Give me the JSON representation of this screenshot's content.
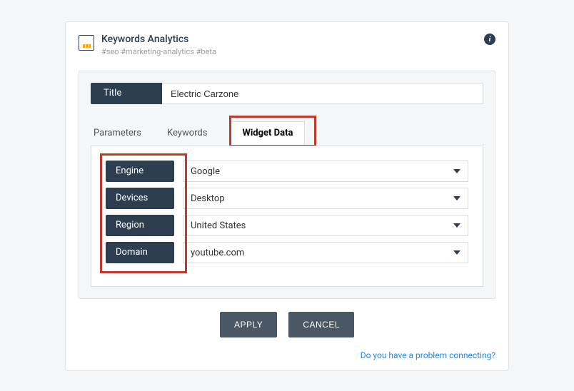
{
  "header": {
    "title": "Keywords Analytics",
    "tags": "#seo #marketing-analytics #beta"
  },
  "title_field": {
    "label": "Title",
    "value": "Electric Carzone"
  },
  "tabs": [
    {
      "label": "Parameters",
      "active": false
    },
    {
      "label": "Keywords",
      "active": false
    },
    {
      "label": "Widget Data",
      "active": true
    }
  ],
  "fields": {
    "engine": {
      "label": "Engine",
      "value": "Google"
    },
    "devices": {
      "label": "Devices",
      "value": "Desktop"
    },
    "region": {
      "label": "Region",
      "value": "United States"
    },
    "domain": {
      "label": "Domain",
      "value": "youtube.com"
    }
  },
  "buttons": {
    "apply": "APPLY",
    "cancel": "CANCEL"
  },
  "footer": {
    "help_link": "Do you have a problem connecting?"
  }
}
